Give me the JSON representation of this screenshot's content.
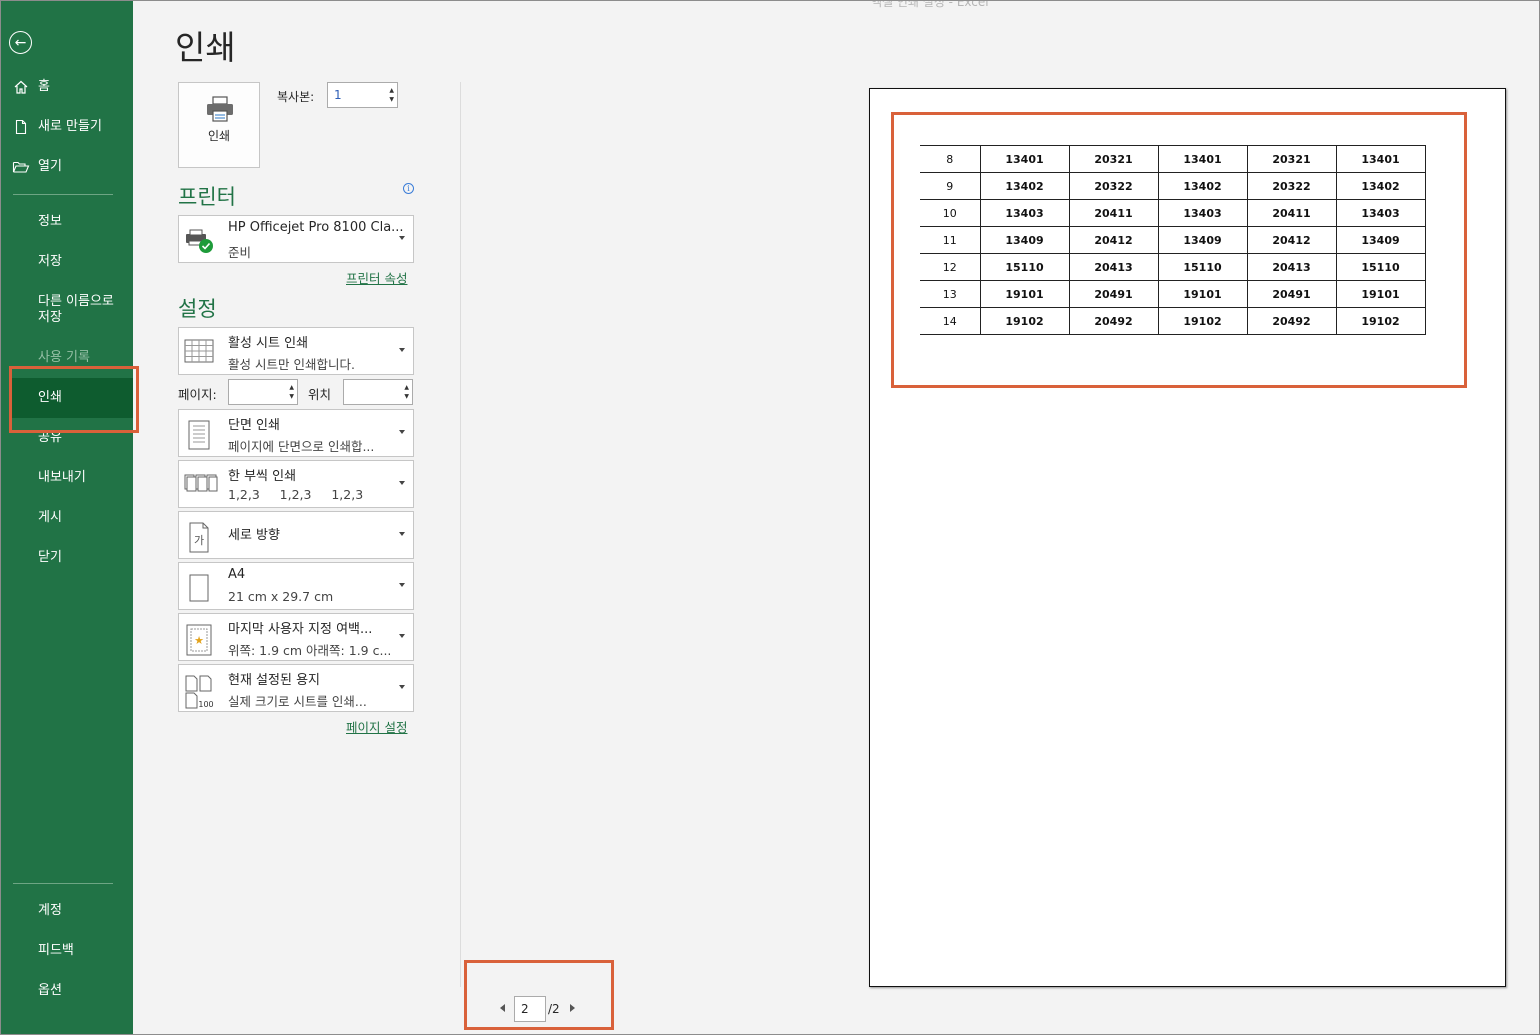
{
  "window": {
    "title": "엑셀 인쇄 설정 - Excel"
  },
  "nav": {
    "back_icon": "back-arrow-icon",
    "items_top": [
      {
        "label": "홈",
        "icon": "home-icon"
      },
      {
        "label": "새로 만들기",
        "icon": "new-document-icon"
      },
      {
        "label": "열기",
        "icon": "open-folder-icon"
      }
    ],
    "info": "정보",
    "save": "저장",
    "save_as_line1": "다른 이름으로",
    "save_as_line2": "저장",
    "history": "사용 기록",
    "print": "인쇄",
    "share": "공유",
    "export": "내보내기",
    "publish": "게시",
    "close": "닫기",
    "account": "계정",
    "feedback": "피드백",
    "options": "옵션"
  },
  "main": {
    "title": "인쇄",
    "print_button": "인쇄",
    "copies_label": "복사본:",
    "copies_value": "1",
    "printer_header": "프린터",
    "printer_name": "HP Officejet Pro 8100 Cla...",
    "printer_status": "준비",
    "printer_properties": "프린터 속성",
    "settings_header": "설정",
    "what_to_print": {
      "line1": "활성 시트 인쇄",
      "line2": "활성 시트만 인쇄합니다."
    },
    "pages_label": "페이지:",
    "pages_from": "",
    "to_label": "위치",
    "pages_to": "",
    "sides": {
      "line1": "단면 인쇄",
      "line2": "페이지에 단면으로 인쇄합..."
    },
    "collate": {
      "line1": "한 부씩 인쇄",
      "line2": "1,2,3     1,2,3     1,2,3"
    },
    "orientation": {
      "line1": "세로 방향"
    },
    "paper": {
      "line1": "A4",
      "line2": "21 cm x 29.7 cm"
    },
    "margins": {
      "line1": "마지막 사용자 지정 여백...",
      "line2": "위쪽: 1.9 cm 아래쪽: 1.9 c..."
    },
    "scaling": {
      "line1": "현재 설정된 용지",
      "line2": "실제 크기로 시트를 인쇄..."
    },
    "page_setup": "페이지 설정"
  },
  "preview": {
    "rows": [
      [
        "8",
        "13401",
        "20321",
        "13401",
        "20321",
        "13401"
      ],
      [
        "9",
        "13402",
        "20322",
        "13402",
        "20322",
        "13402"
      ],
      [
        "10",
        "13403",
        "20411",
        "13403",
        "20411",
        "13403"
      ],
      [
        "11",
        "13409",
        "20412",
        "13409",
        "20412",
        "13409"
      ],
      [
        "12",
        "15110",
        "20413",
        "15110",
        "20413",
        "15110"
      ],
      [
        "13",
        "19101",
        "20491",
        "19101",
        "20491",
        "19101"
      ],
      [
        "14",
        "19102",
        "20492",
        "19102",
        "20492",
        "19102"
      ]
    ],
    "current_page": "2",
    "total_pages": "/2"
  },
  "colors": {
    "nav_bg": "#217346",
    "nav_selected": "#0e5c2f",
    "accent": "#217346",
    "highlight": "#d9613a"
  }
}
